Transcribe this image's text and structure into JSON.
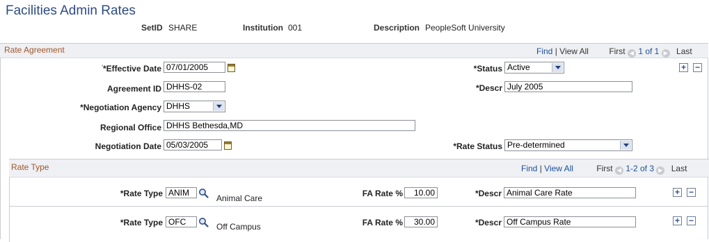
{
  "page_title": "Facilities Admin Rates",
  "header": {
    "setid_label": "SetID",
    "setid_value": "SHARE",
    "institution_label": "Institution",
    "institution_value": "001",
    "description_label": "Description",
    "description_value": "PeopleSoft University"
  },
  "rate_agreement": {
    "section_title": "Rate Agreement",
    "nav": {
      "find": "Find",
      "view_all": "View All",
      "first": "First",
      "count": "1 of 1",
      "last": "Last"
    },
    "effective_date_label": "*Effective Date",
    "effective_date": "07/01/2005",
    "status_label": "*Status",
    "status": "Active",
    "agreement_id_label": "Agreement ID",
    "agreement_id": "DHHS-02",
    "descr_label": "*Descr",
    "descr": "July 2005",
    "negotiation_agency_label": "*Negotiation Agency",
    "negotiation_agency": "DHHS",
    "regional_office_label": "Regional Office",
    "regional_office": "DHHS Bethesda,MD",
    "negotiation_date_label": "Negotiation Date",
    "negotiation_date": "05/03/2005",
    "rate_status_label": "*Rate Status",
    "rate_status": "Pre-determined"
  },
  "rate_type": {
    "section_title": "Rate Type",
    "nav": {
      "find": "Find",
      "view_all": "View All",
      "first": "First",
      "count": "1-2 of 3",
      "last": "Last"
    },
    "rows": [
      {
        "rate_type_label": "*Rate Type",
        "rate_type": "ANIM",
        "rate_type_desc": "Animal Care",
        "fa_rate_label": "FA Rate %",
        "fa_rate": "10.00",
        "descr_label": "*Descr",
        "descr": "Animal Care Rate"
      },
      {
        "rate_type_label": "*Rate Type",
        "rate_type": "OFC",
        "rate_type_desc": "Off Campus",
        "fa_rate_label": "FA Rate %",
        "fa_rate": "30.00",
        "descr_label": "*Descr",
        "descr": "Off Campus Rate"
      }
    ]
  },
  "controls": {
    "add_symbol": "+",
    "delete_symbol": "−",
    "prev_symbol": "◀",
    "next_symbol": "▶",
    "separator": "|"
  }
}
